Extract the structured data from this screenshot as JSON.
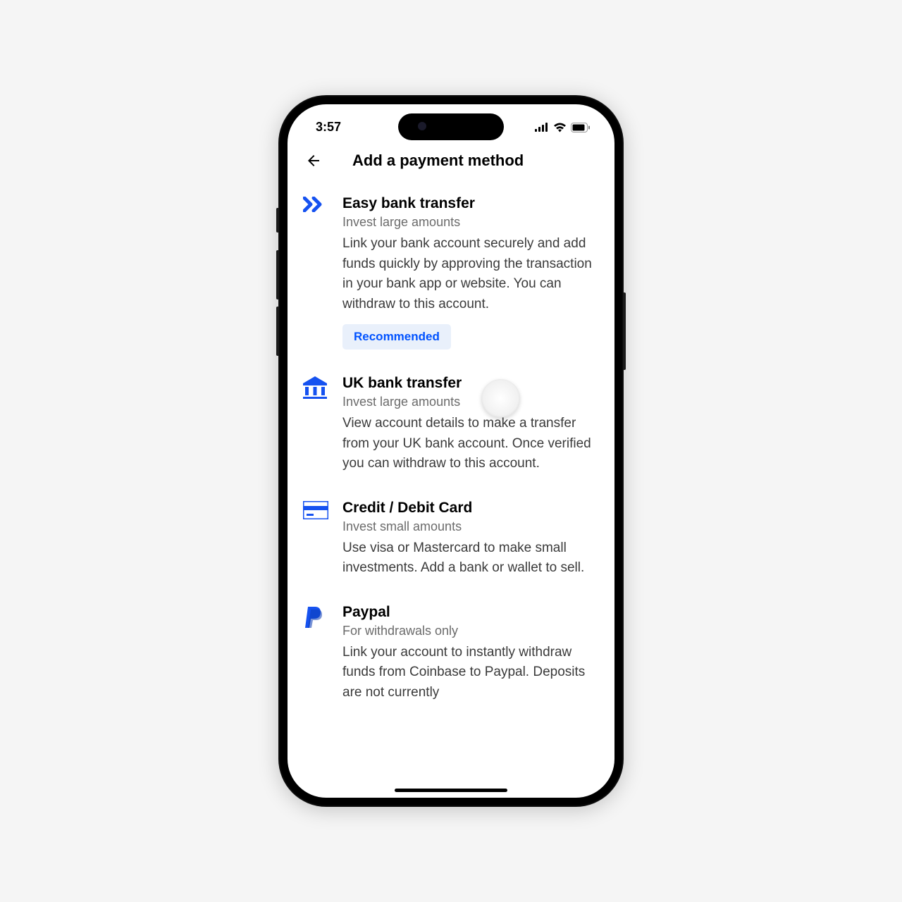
{
  "status": {
    "time": "3:57"
  },
  "nav": {
    "title": "Add a payment method"
  },
  "methods": [
    {
      "title": "Easy bank transfer",
      "subtitle": "Invest large amounts",
      "desc": "Link your bank account securely and add funds quickly by approving the transaction in your bank app or website. You can withdraw to this account.",
      "badge": "Recommended"
    },
    {
      "title": "UK bank transfer",
      "subtitle": "Invest large amounts",
      "desc": "View account details to make a transfer from your UK bank account. Once verified you can withdraw to this account."
    },
    {
      "title": "Credit / Debit Card",
      "subtitle": "Invest small amounts",
      "desc": "Use visa or Mastercard to make small investments. Add a bank or wallet to sell."
    },
    {
      "title": "Paypal",
      "subtitle": "For withdrawals only",
      "desc": "Link your account to instantly withdraw funds from Coinbase to Paypal. Deposits are not currently"
    }
  ],
  "colors": {
    "accent": "#1652f0"
  }
}
